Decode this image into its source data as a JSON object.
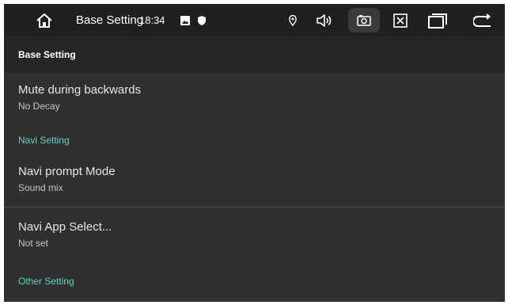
{
  "statusbar": {
    "title": "Base Setting",
    "time": "18:34",
    "icons": [
      "home-icon",
      "gallery-icon",
      "shield-icon",
      "location-icon",
      "volume-icon",
      "screenshot-icon",
      "close-window-icon",
      "recent-apps-icon",
      "back-icon"
    ]
  },
  "header": {
    "title": "Base Setting"
  },
  "items": [
    {
      "title": "Mute during backwards",
      "summary": "No Decay"
    },
    {
      "title": "Navi prompt Mode",
      "summary": "Sound mix"
    },
    {
      "title": "Navi App Select...",
      "summary": "Not set"
    }
  ],
  "categories": {
    "navi": "Navi Setting",
    "other": "Other Setting"
  },
  "colors": {
    "accent": "#5fd3c4",
    "background": "#303030",
    "topbar": "#202020",
    "header": "#262626"
  }
}
